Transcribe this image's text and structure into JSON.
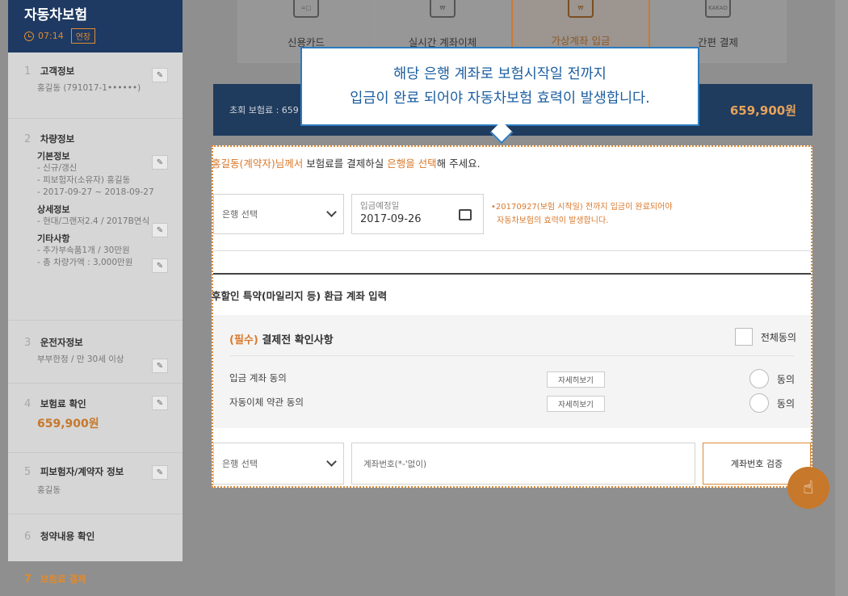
{
  "sidebar": {
    "title": "자동차보험",
    "timer": "07:14",
    "extend_label": "연장",
    "steps": [
      {
        "num": "1",
        "name": "고객정보",
        "sub": "홍길동 (791017-1••••••)"
      },
      {
        "num": "2",
        "name": "차량정보",
        "basic_title": "기본정보",
        "basic_lines": [
          "- 신규/갱신",
          "- 피보험자(소유자) 홍길동",
          "- 2017-09-27 ~ 2018-09-27"
        ],
        "detail_title": "상세정보",
        "detail_lines": [
          "- 현대/그랜저2.4 / 2017B연식"
        ],
        "etc_title": "기타사항",
        "etc_lines": [
          "- 추가부속품1개 / 30만원",
          "- 총 차량가액 : 3,000만원"
        ]
      },
      {
        "num": "3",
        "name": "운전자정보",
        "sub": "부부한정 / 만 30세 이상"
      },
      {
        "num": "4",
        "name": "보험료 확인",
        "price": "659,900원"
      },
      {
        "num": "5",
        "name": "피보험자/계약자 정보",
        "sub": "홍길동"
      },
      {
        "num": "6",
        "name": "청약내용 확인"
      },
      {
        "num": "7",
        "name": "보험료 결제"
      }
    ]
  },
  "payment": {
    "tabs": [
      {
        "label": "신용카드",
        "icon": "card-icon"
      },
      {
        "label": "실시간 계좌이체",
        "icon": "transfer-icon"
      },
      {
        "label": "가상계좌 입금",
        "icon": "virtual-account-icon"
      },
      {
        "label": "간편 결제",
        "icon": "kakao-icon",
        "icon_text": "KAKAO"
      }
    ],
    "total_label": "초회 보험료 : 659",
    "total_amount": "659,900원"
  },
  "tooltip": {
    "line1": "해당 은행 계좌로 보험시작일 전까지",
    "line2": "입금이 완료 되어야 자동차보험 효력이 발생합니다."
  },
  "guide": {
    "name": "홍길동(계약자)님께서",
    "middle": " 보험료를 결제하실 ",
    "bank": "은행을 선택",
    "end": "해 주세요."
  },
  "bank_select": {
    "placeholder": "은행 선택"
  },
  "deposit_date": {
    "label": "입금예정일",
    "value": "2017-09-26"
  },
  "date_note": {
    "line1": "•20170927(보험 시작일) 전까지 입금이 완료되어야",
    "line2": "자동차보험의 효력이 발생합니다."
  },
  "refund": {
    "title": "후할인 특약(마일리지 등) 환급 계좌 입력"
  },
  "confirm": {
    "required": "(필수)",
    "title": " 결제전 확인사항",
    "agree_all": "전체동의",
    "rows": [
      {
        "label": "입금 계좌 동의",
        "detail": "자세히보기",
        "agree": "동의"
      },
      {
        "label": "자동이체 약관 동의",
        "detail": "자세히보기",
        "agree": "동의"
      }
    ]
  },
  "account": {
    "bank_placeholder": "은행 선택",
    "number_placeholder": "계좌번호(*-'없이)",
    "verify_label": "계좌번호 검증"
  },
  "colors": {
    "accent": "#d9792c",
    "navy": "#1e3a63",
    "tooltip_blue": "#2c7bc0"
  }
}
